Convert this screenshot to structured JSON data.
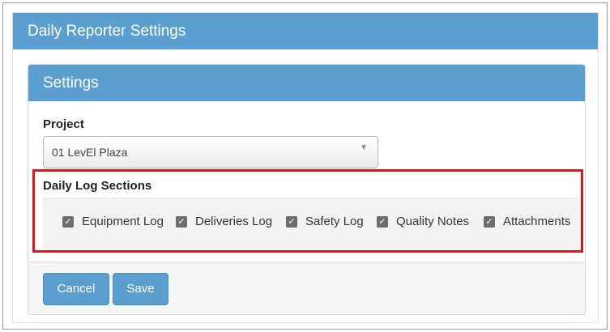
{
  "app": {
    "title": "Daily Reporter Settings"
  },
  "settings": {
    "title": "Settings",
    "project": {
      "label": "Project",
      "selected": "01 LevEl Plaza"
    },
    "sections": {
      "label": "Daily Log Sections",
      "items": [
        {
          "label": "Equipment Log",
          "checked": true
        },
        {
          "label": "Deliveries Log",
          "checked": true
        },
        {
          "label": "Safety Log",
          "checked": true
        },
        {
          "label": "Quality Notes",
          "checked": true
        },
        {
          "label": "Attachments",
          "checked": true
        }
      ]
    }
  },
  "footer": {
    "cancel_label": "Cancel",
    "save_label": "Save"
  },
  "colors": {
    "header": "#5b9fd0",
    "highlight": "#e0161b",
    "checkbox": "#6d6d6d"
  }
}
